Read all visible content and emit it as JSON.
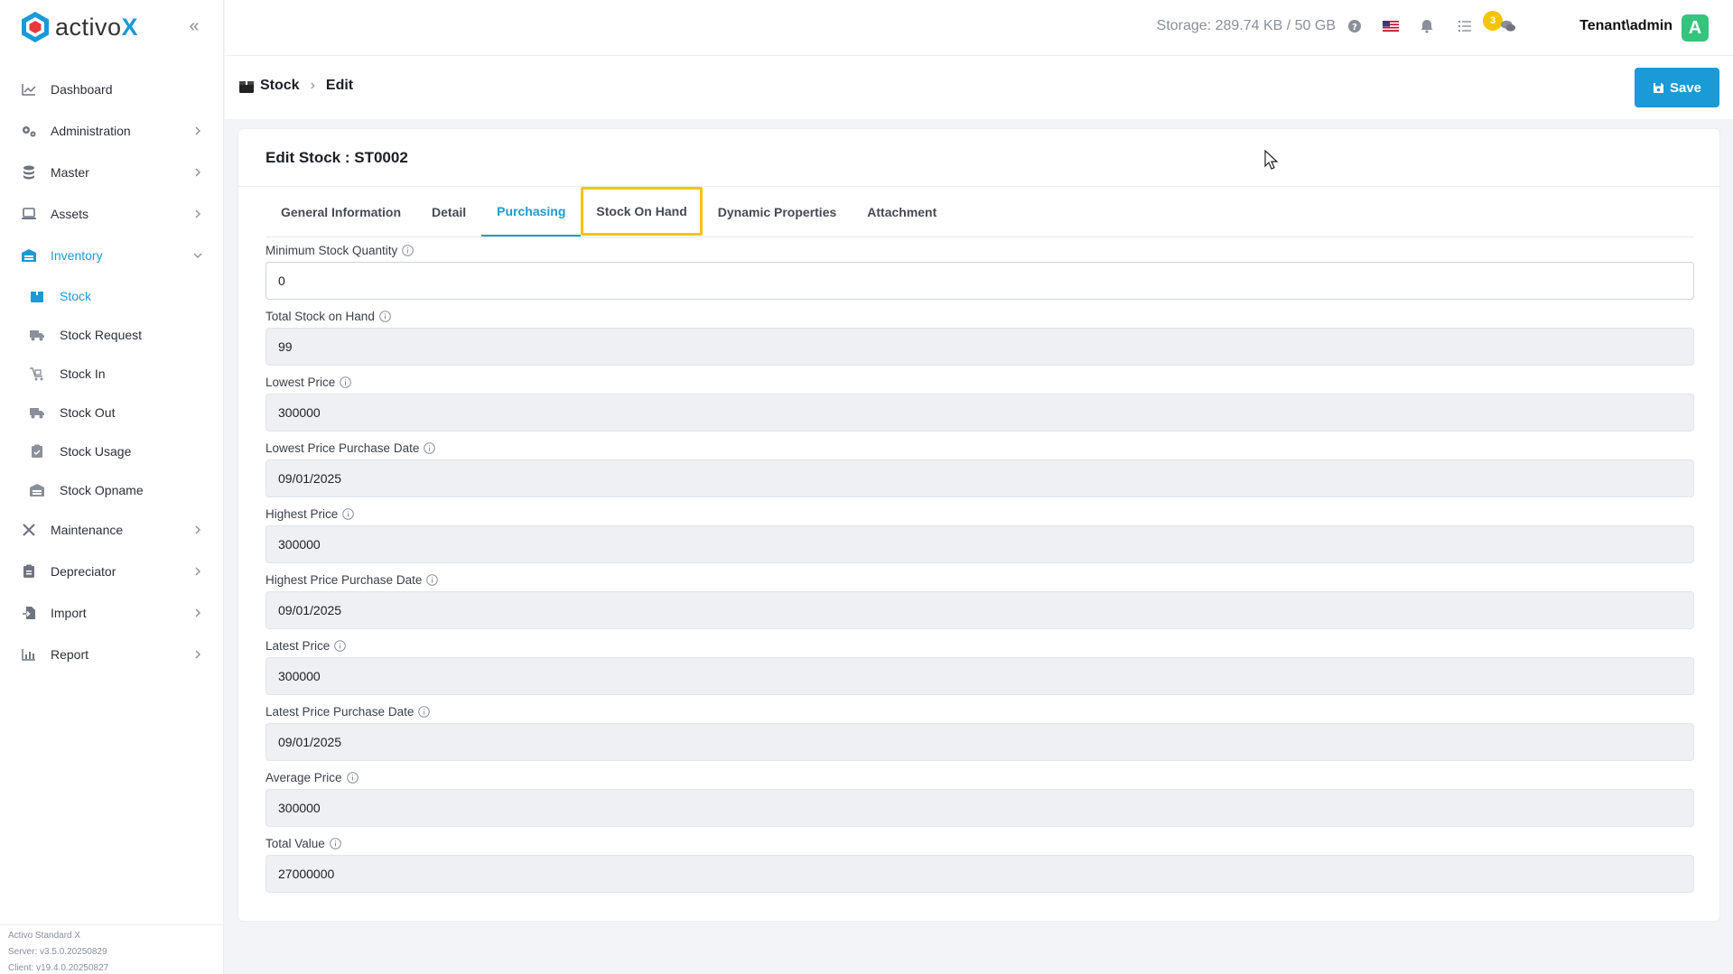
{
  "app": {
    "logo_main": "activo",
    "logo_accent": "X"
  },
  "sidebar": {
    "items": [
      {
        "label": "Dashboard",
        "icon": "chart-line-icon",
        "has_children": false
      },
      {
        "label": "Administration",
        "icon": "gears-icon",
        "has_children": true
      },
      {
        "label": "Master",
        "icon": "database-icon",
        "has_children": true
      },
      {
        "label": "Assets",
        "icon": "laptop-icon",
        "has_children": true
      },
      {
        "label": "Inventory",
        "icon": "warehouse-icon",
        "has_children": true,
        "expanded": true
      }
    ],
    "sub_items": [
      {
        "label": "Stock",
        "icon": "box-icon",
        "active": true
      },
      {
        "label": "Stock Request",
        "icon": "truck-icon"
      },
      {
        "label": "Stock In",
        "icon": "cart-in-icon"
      },
      {
        "label": "Stock Out",
        "icon": "truck-out-icon"
      },
      {
        "label": "Stock Usage",
        "icon": "clipboard-check-icon"
      },
      {
        "label": "Stock Opname",
        "icon": "warehouse-icon"
      }
    ],
    "items_after": [
      {
        "label": "Maintenance",
        "icon": "tools-icon"
      },
      {
        "label": "Depreciator",
        "icon": "clipboard-icon"
      },
      {
        "label": "Import",
        "icon": "file-import-icon"
      },
      {
        "label": "Report",
        "icon": "chart-bar-icon"
      }
    ],
    "version": {
      "product": "Activo Standard X",
      "server": "Server: v3.5.0.20250829",
      "client": "Client: v19.4.0.20250827"
    }
  },
  "topbar": {
    "storage": "Storage: 289.74 KB / 50 GB",
    "notification_count": "3",
    "user": "Tenant\\admin",
    "avatar_initial": "A"
  },
  "breadcrumb": {
    "root": "Stock",
    "current": "Edit"
  },
  "toolbar": {
    "save_label": "Save"
  },
  "card": {
    "title": "Edit Stock : ST0002",
    "tabs": [
      {
        "label": "General Information"
      },
      {
        "label": "Detail"
      },
      {
        "label": "Purchasing"
      },
      {
        "label": "Stock On Hand"
      },
      {
        "label": "Dynamic Properties"
      },
      {
        "label": "Attachment"
      }
    ],
    "active_tab": "Purchasing",
    "highlighted_tab": "Stock On Hand"
  },
  "fields": [
    {
      "label": "Minimum Stock Quantity",
      "value": "0",
      "editable": true
    },
    {
      "label": "Total Stock on Hand",
      "value": "99"
    },
    {
      "label": "Lowest Price",
      "value": "300000"
    },
    {
      "label": "Lowest Price Purchase Date",
      "value": "09/01/2025"
    },
    {
      "label": "Highest Price",
      "value": "300000"
    },
    {
      "label": "Highest Price Purchase Date",
      "value": "09/01/2025"
    },
    {
      "label": "Latest Price",
      "value": "300000"
    },
    {
      "label": "Latest Price Purchase Date",
      "value": "09/01/2025"
    },
    {
      "label": "Average Price",
      "value": "300000"
    },
    {
      "label": "Total Value",
      "value": "27000000"
    }
  ],
  "colors": {
    "accent": "#1a9ad6",
    "highlight": "#f5c400",
    "avatar": "#34c47c"
  }
}
